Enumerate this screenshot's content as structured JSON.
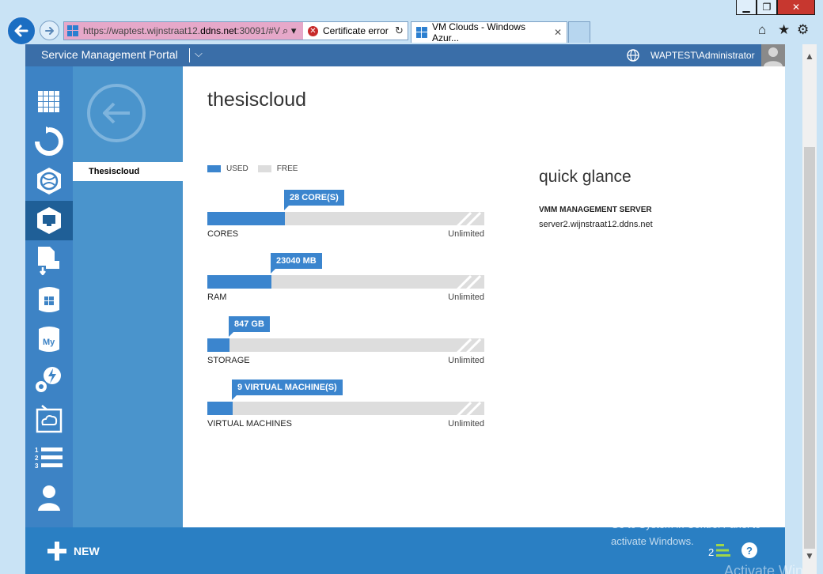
{
  "browser": {
    "window_controls": {
      "minimize": "▁",
      "maximize": "❐",
      "close": "✕"
    },
    "address": {
      "url_prefix": "https://waptest.wijnstraat12.",
      "url_host": "ddns.net",
      "url_suffix": ":30091/#V",
      "search_glyph": "⌕ ▾",
      "cert_label": "Certificate error",
      "refresh_glyph": "↻"
    },
    "tab": {
      "title": "VM Clouds - Windows Azur...",
      "close": "✕"
    },
    "toolbar": {
      "home": "⌂",
      "favorites": "★",
      "tools": "⚙"
    }
  },
  "portal": {
    "title": "Service Management Portal",
    "dropdown_glyph": "⌵",
    "user": "WAPTEST\\Administrator"
  },
  "subnav": {
    "item": "Thesiscloud"
  },
  "page": {
    "title": "thesiscloud",
    "legend": {
      "used": "USED",
      "free": "FREE"
    },
    "metrics": [
      {
        "name": "CORES",
        "tag": "28 CORE(S)",
        "limit": "Unlimited",
        "used_fraction": 0.28
      },
      {
        "name": "RAM",
        "tag": "23040 MB",
        "limit": "Unlimited",
        "used_fraction": 0.23
      },
      {
        "name": "STORAGE",
        "tag": "847 GB",
        "limit": "Unlimited",
        "used_fraction": 0.08
      },
      {
        "name": "VIRTUAL MACHINES",
        "tag": "9 VIRTUAL MACHINE(S)",
        "limit": "Unlimited",
        "used_fraction": 0.09
      }
    ],
    "glance": {
      "title": "quick glance",
      "label": "VMM MANAGEMENT SERVER",
      "value": "server2.wijnstraat12.ddns.net"
    }
  },
  "bottom": {
    "new_label": "NEW",
    "operations_count": "2",
    "help": "?"
  },
  "watermark": {
    "title": "Activate Windows",
    "subtitle": "Go to System in Control Panel to activate Windows.",
    "echo": "Activate Wind"
  },
  "scrollbar": {
    "up": "▲",
    "down": "▼"
  },
  "colors": {
    "accent": "#3b85ce",
    "topbar": "#3a6ea8",
    "leftnav": "#3d83c5",
    "subnav": "#4a94cc",
    "bottombar": "#2a7fc3",
    "free_track": "#dddddd"
  }
}
